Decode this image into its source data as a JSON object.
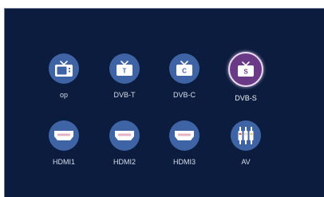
{
  "colors": {
    "background": "#0c1c3e",
    "icon_circle": "#3f64a5",
    "selected_circle": "#6a3a86",
    "icon_fill": "#ffffff",
    "label_text": "#d7deea"
  },
  "sources": [
    {
      "label": "op",
      "icon": "tv-icon",
      "letter": "",
      "selected": false
    },
    {
      "label": "DVB-T",
      "icon": "tv-antenna-icon",
      "letter": "T",
      "selected": false
    },
    {
      "label": "DVB-C",
      "icon": "tv-antenna-icon",
      "letter": "C",
      "selected": false
    },
    {
      "label": "DVB-S",
      "icon": "tv-antenna-icon",
      "letter": "S",
      "selected": true
    },
    {
      "label": "HDMI1",
      "icon": "hdmi-icon",
      "letter": "",
      "selected": false
    },
    {
      "label": "HDMI2",
      "icon": "hdmi-icon",
      "letter": "",
      "selected": false
    },
    {
      "label": "HDMI3",
      "icon": "hdmi-icon",
      "letter": "",
      "selected": false
    },
    {
      "label": "AV",
      "icon": "av-connector-icon",
      "letter": "",
      "selected": false
    }
  ]
}
